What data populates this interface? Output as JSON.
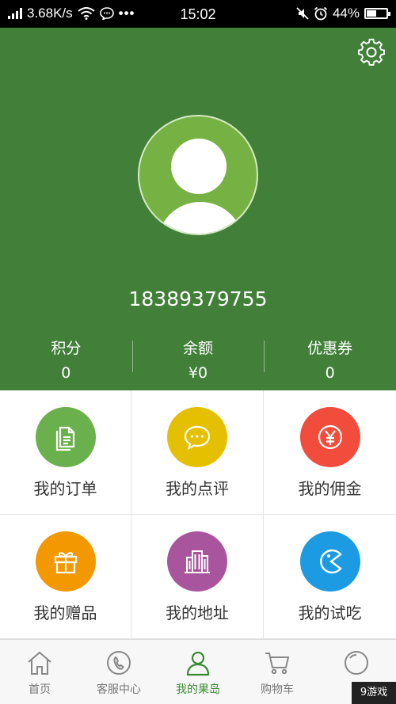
{
  "status_bar": {
    "speed": "3.68K/s",
    "time": "15:02",
    "battery": "44%"
  },
  "profile": {
    "phone": "18389379755"
  },
  "stats": [
    {
      "label": "积分",
      "value": "0"
    },
    {
      "label": "余额",
      "value": "¥0"
    },
    {
      "label": "优惠券",
      "value": "0"
    }
  ],
  "menu": [
    {
      "label": "我的订单",
      "color": "#6ab04c",
      "icon": "orders-icon"
    },
    {
      "label": "我的点评",
      "color": "#e5c000",
      "icon": "comment-icon"
    },
    {
      "label": "我的佣金",
      "color": "#f14c3c",
      "icon": "commission-icon"
    },
    {
      "label": "我的赠品",
      "color": "#f39800",
      "icon": "gift-icon"
    },
    {
      "label": "我的地址",
      "color": "#a9559e",
      "icon": "building-icon"
    },
    {
      "label": "我的试吃",
      "color": "#1c9be2",
      "icon": "pacman-icon"
    }
  ],
  "tabs": [
    {
      "label": "首页",
      "icon": "home-icon"
    },
    {
      "label": "客服中心",
      "icon": "phone-icon"
    },
    {
      "label": "我的果岛",
      "icon": "user-icon",
      "active": true
    },
    {
      "label": "购物车",
      "icon": "cart-icon"
    },
    {
      "label": "",
      "icon": "circle-icon"
    }
  ],
  "watermark": "9游戏",
  "colors": {
    "header": "#42803a",
    "avatar": "#76b243",
    "active_tab": "#3a8a33"
  }
}
